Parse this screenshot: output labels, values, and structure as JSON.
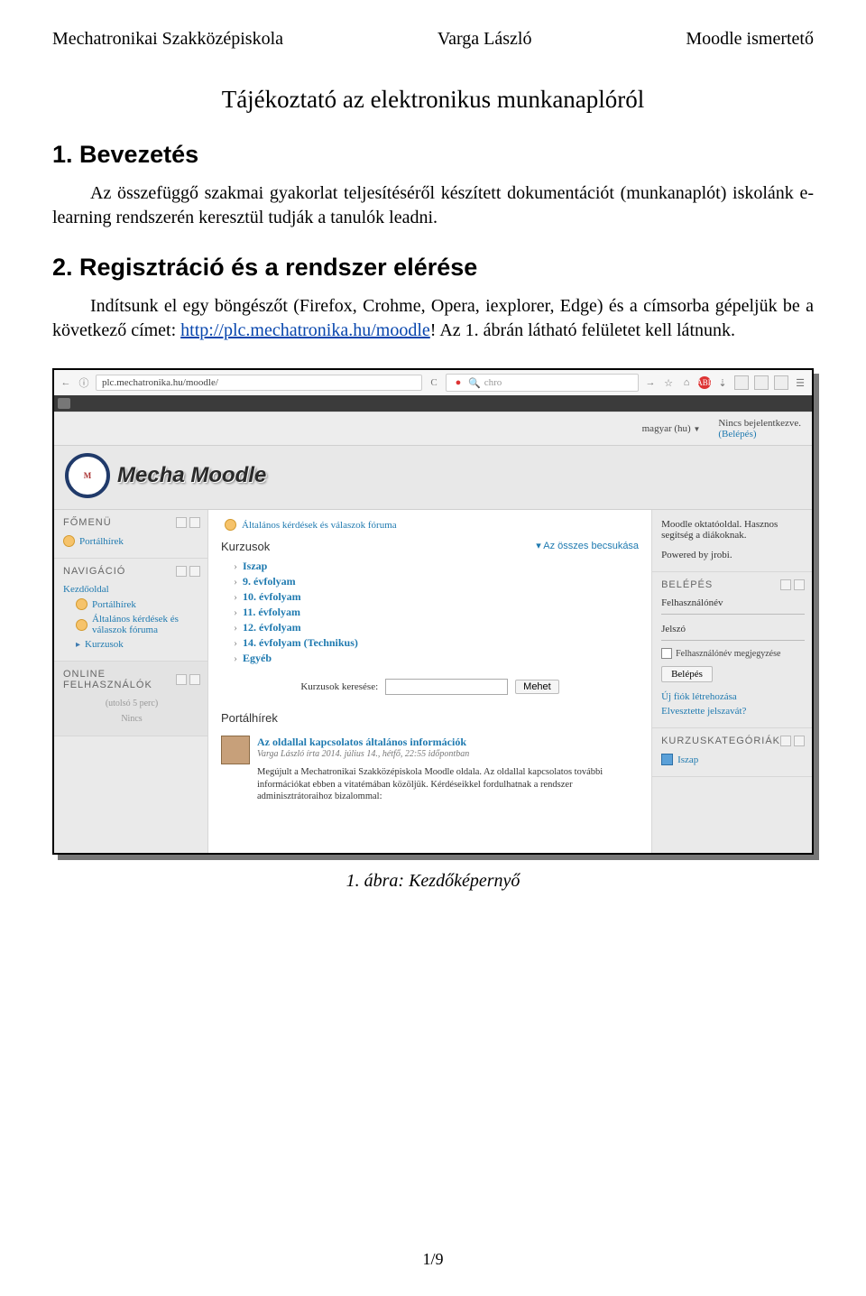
{
  "header": {
    "left": "Mechatronikai Szakközépiskola",
    "center": "Varga László",
    "right": "Moodle ismertető"
  },
  "title": "Tájékoztató az elektronikus munkanaplóról",
  "section1": {
    "heading": "1. Bevezetés",
    "para": "Az összefüggő szakmai gyakorlat teljesítéséről készített dokumentációt (munkanaplót) iskolánk e-learning rendszerén keresztül tudják a tanulók leadni."
  },
  "section2": {
    "heading": "2. Regisztráció és a rendszer elérése",
    "para_pre": "Indítsunk el egy böngészőt (Firefox, Crohme, Opera, iexplorer, Edge) és a címsorba gépeljük be a következő címet: ",
    "link_text": "http://plc.mechatronika.hu/moodle",
    "para_post": "! Az 1. ábrán látható felületet kell látnunk."
  },
  "screenshot": {
    "browser": {
      "url": "plc.mechatronika.hu/moodle/",
      "search_placeholder": "chro",
      "reload_label": "C",
      "arrow_right": "→",
      "star": "☆"
    },
    "topbar": {
      "lang": "magyar (hu)",
      "caret": "▼",
      "not_logged": "Nincs bejelentkezve.",
      "login": "(Belépés)"
    },
    "site_title": "Mecha Moodle",
    "left_blocks": {
      "fomenu": {
        "title": "FŐMENÜ",
        "item": "Portálhírek"
      },
      "nav": {
        "title": "NAVIGÁCIÓ",
        "items": [
          "Kezdőoldal",
          "Portálhírek",
          "Általános kérdések és válaszok fóruma",
          "Kurzusok"
        ]
      },
      "online": {
        "title": "ONLINE FELHASZNÁLÓK",
        "sub": "(utolsó 5 perc)",
        "none": "Nincs"
      }
    },
    "mid": {
      "forum_link": "Általános kérdések és válaszok fóruma",
      "kurzusok_title": "Kurzusok",
      "collapse": "Az összes becsukása",
      "collapse_caret": "▾",
      "courses": [
        "Iszap",
        "9. évfolyam",
        "10. évfolyam",
        "11. évfolyam",
        "12. évfolyam",
        "14. évfolyam (Technikus)",
        "Egyéb"
      ],
      "search_label": "Kurzusok keresése:",
      "search_btn": "Mehet",
      "portal_title": "Portálhírek",
      "news": {
        "title": "Az oldallal kapcsolatos általános információk",
        "meta": "Varga László írta 2014. július 14., hétfő, 22:55 időpontban",
        "body": "Megújult a Mechatronikai Szakközépiskola Moodle oldala. Az oldallal kapcsolatos további információkat ebben a vitatémában közöljük. Kérdéseikkel fordulhatnak a rendszer adminisztrátoraihoz bizalommal:"
      }
    },
    "right_blocks": {
      "intro": {
        "line1": "Moodle oktatóoldal. Hasznos segítség a diákoknak.",
        "line2": "Powered by jrobi."
      },
      "login": {
        "title": "BELÉPÉS",
        "user": "Felhasználónév",
        "pass": "Jelszó",
        "remember": "Felhasználónév megjegyzése",
        "btn": "Belépés",
        "new_account": "Új fiók létrehozása",
        "forgot": "Elvesztette jelszavát?"
      },
      "categories": {
        "title": "KURZUSKATEGÓRIÁK",
        "item": "Iszap"
      }
    }
  },
  "figure_caption": "1. ábra: Kezdőképernyő",
  "page_number": "1/9"
}
